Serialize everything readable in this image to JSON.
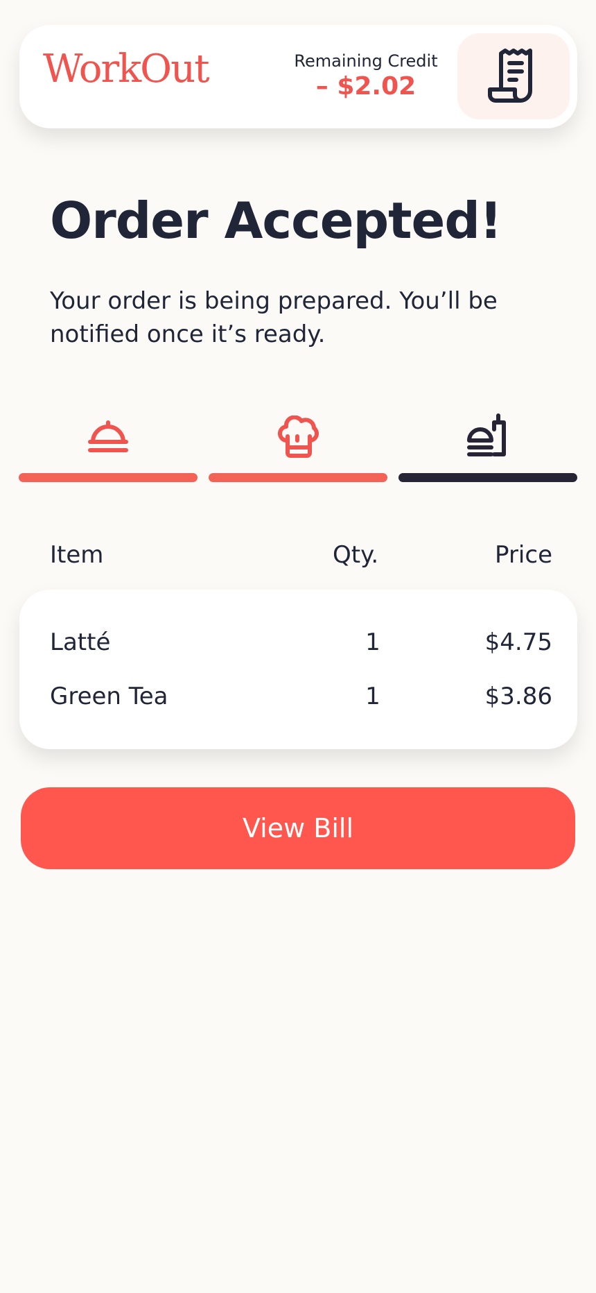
{
  "header": {
    "logo": "WorkOut",
    "credit_label": "Remaining Credit",
    "credit_value": "– $2.02",
    "receipt_icon": "receipt-icon"
  },
  "order": {
    "title": "Order Accepted!",
    "subtitle": "Your order is being prepared. You’ll be notified once it’s ready."
  },
  "steps": [
    {
      "icon": "cloche-icon",
      "status": "done",
      "color": "#f0544f"
    },
    {
      "icon": "chef-hat-icon",
      "status": "done",
      "color": "#f0544f"
    },
    {
      "icon": "food-tray-icon",
      "status": "current",
      "color": "#272436"
    }
  ],
  "table": {
    "headers": {
      "item": "Item",
      "qty": "Qty.",
      "price": "Price"
    },
    "rows": [
      {
        "item": "Latté",
        "qty": "1",
        "price": "$4.75"
      },
      {
        "item": "Green Tea",
        "qty": "1",
        "price": "$3.86"
      }
    ]
  },
  "actions": {
    "view_bill": "View Bill"
  },
  "colors": {
    "accent": "#f0544f",
    "button": "#ff564e",
    "dark": "#272436",
    "background": "#fbfaf7"
  }
}
